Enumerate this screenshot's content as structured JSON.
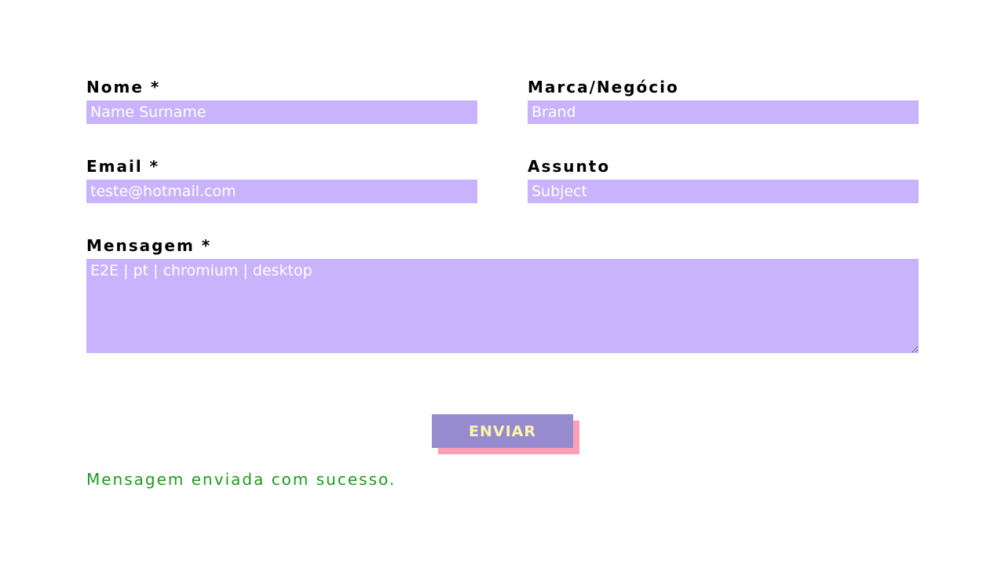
{
  "form": {
    "fields": {
      "name": {
        "label": "Nome *",
        "placeholder": "Name Surname",
        "value": ""
      },
      "brand": {
        "label": "Marca/Negócio",
        "placeholder": "Brand",
        "value": ""
      },
      "email": {
        "label": "Email *",
        "placeholder": "",
        "value": "teste@hotmail.com"
      },
      "subject": {
        "label": "Assunto",
        "placeholder": "Subject",
        "value": ""
      },
      "message": {
        "label": "Mensagem *",
        "placeholder": "",
        "value": "E2E | pt | chromium | desktop"
      }
    },
    "submit_label": "ENVIAR",
    "success_message": "Mensagem enviada com sucesso."
  },
  "colors": {
    "input_background": "#c9b3fd",
    "input_text": "#ffffff",
    "button_background": "#978bd0",
    "button_text": "#fff5a8",
    "button_shadow": "#ff9fb6",
    "success_text": "#1e9a1e",
    "label_text": "#000000"
  }
}
